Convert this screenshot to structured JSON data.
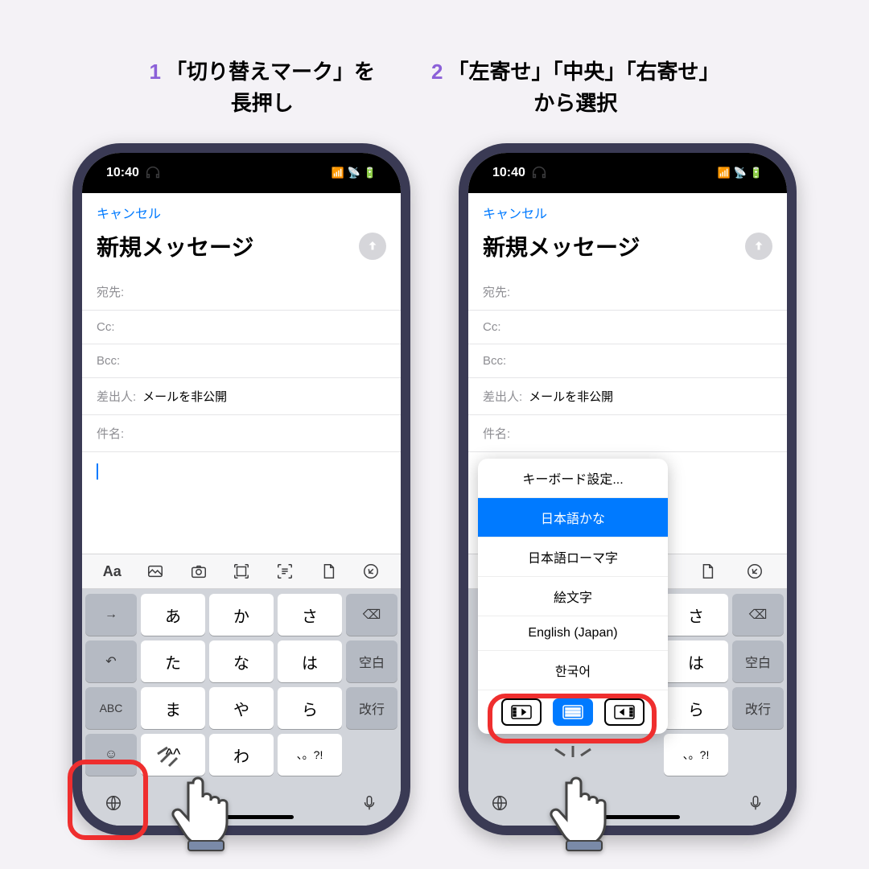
{
  "captions": {
    "step1": {
      "num": "1",
      "text_line1": "「切り替えマーク」を",
      "text_line2": "長押し"
    },
    "step2": {
      "num": "2",
      "text_line1": "「左寄せ」「中央」「右寄せ」",
      "text_line2": "から選択"
    }
  },
  "status": {
    "time": "10:40",
    "headphone": "🎧",
    "signal": "▮▮▮▮",
    "wifi": "◉",
    "battery": "▭"
  },
  "nav": {
    "cancel": "キャンセル"
  },
  "compose": {
    "title": "新規メッセージ",
    "to_label": "宛先:",
    "cc_label": "Cc:",
    "bcc_label": "Bcc:",
    "from_label": "差出人:",
    "from_value": "メールを非公開",
    "subject_label": "件名:"
  },
  "toolbar_icons": [
    "Aa",
    "photo",
    "camera",
    "scan-doc",
    "scan-text",
    "file",
    "markup"
  ],
  "keyboard": {
    "rows": [
      {
        "side_l": "→",
        "keys": [
          "あ",
          "か",
          "さ"
        ],
        "side_r": "⌫"
      },
      {
        "side_l": "↶",
        "keys": [
          "た",
          "な",
          "は"
        ],
        "side_r": "空白"
      },
      {
        "side_l": "ABC",
        "keys": [
          "ま",
          "や",
          "ら"
        ],
        "side_r": "改行"
      },
      {
        "side_l": "☺",
        "keys": [
          "^^",
          "わ",
          "、。?!"
        ],
        "side_r": ""
      }
    ]
  },
  "bottom": {
    "globe": "globe-icon",
    "mic": "mic-icon"
  },
  "popup": {
    "settings": "キーボード設定...",
    "items": [
      "日本語かな",
      "日本語ローマ字",
      "絵文字",
      "English (Japan)",
      "한국어"
    ],
    "selected_index": 0
  }
}
